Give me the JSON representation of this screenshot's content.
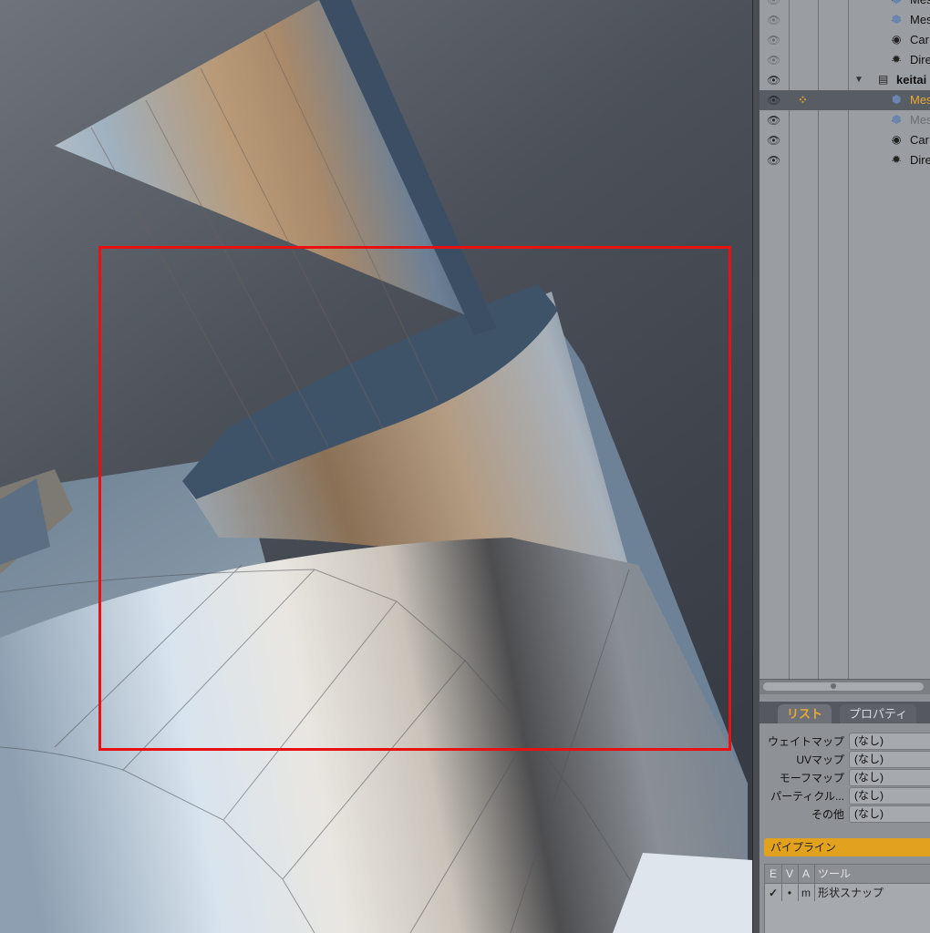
{
  "outliner": {
    "items": [
      {
        "eye": "visible-dim",
        "icon": "mesh-icon",
        "label": "Mes",
        "state": "normal"
      },
      {
        "eye": "visible-dim",
        "icon": "mesh-icon",
        "label": "Mes",
        "state": "normal"
      },
      {
        "eye": "visible-dim",
        "icon": "camera-icon",
        "label": "Car",
        "state": "normal"
      },
      {
        "eye": "visible-dim",
        "icon": "light-icon",
        "label": "Dire",
        "state": "normal"
      },
      {
        "eye": "visible",
        "icon": "scene-icon",
        "label": "keitai",
        "state": "group"
      },
      {
        "eye": "visible",
        "icon": "mesh-icon",
        "label": "Mes",
        "state": "selected"
      },
      {
        "eye": "visible",
        "icon": "mesh-icon",
        "label": "Mes",
        "state": "dim"
      },
      {
        "eye": "visible",
        "icon": "camera-icon",
        "label": "Car",
        "state": "normal"
      },
      {
        "eye": "visible",
        "icon": "light-icon",
        "label": "Dire",
        "state": "normal"
      }
    ]
  },
  "tabs": {
    "list": "リスト",
    "properties": "プロパティ"
  },
  "maps": [
    {
      "label": "ウェイトマップ",
      "value": "(なし)"
    },
    {
      "label": "UVマップ",
      "value": "(なし)"
    },
    {
      "label": "モーフマップ",
      "value": "(なし)"
    },
    {
      "label": "パーティクル...",
      "value": "(なし)"
    },
    {
      "label": "その他",
      "value": "(なし)"
    }
  ],
  "pipeline": {
    "title": "パイプライン",
    "headers": {
      "e": "E",
      "v": "V",
      "a": "A",
      "tool": "ツール"
    },
    "rows": [
      {
        "e": "✓",
        "v": "•",
        "a": "m",
        "tool": "形状スナップ"
      }
    ]
  },
  "colors": {
    "selection_box": "#e81010",
    "accent": "#e3a21e"
  }
}
